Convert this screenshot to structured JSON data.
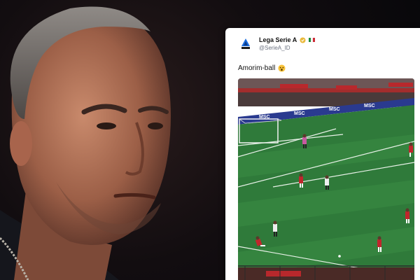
{
  "tweet": {
    "display_name": "Lega Serie A",
    "handle": "@SerieA_ID",
    "text": "Amorim-ball",
    "emoji": "surprised-face-icon"
  },
  "media": {
    "ad_boards": [
      "MSC",
      "MSC",
      "MSC",
      "MSC"
    ]
  },
  "colors": {
    "card_bg": "#ffffff",
    "pitch_green": "#2f7a3a",
    "verified_gold": "#e9b93a",
    "team_red": "#c0262c",
    "team_white": "#eeeeee",
    "keeper_pink": "#c75aa0"
  }
}
